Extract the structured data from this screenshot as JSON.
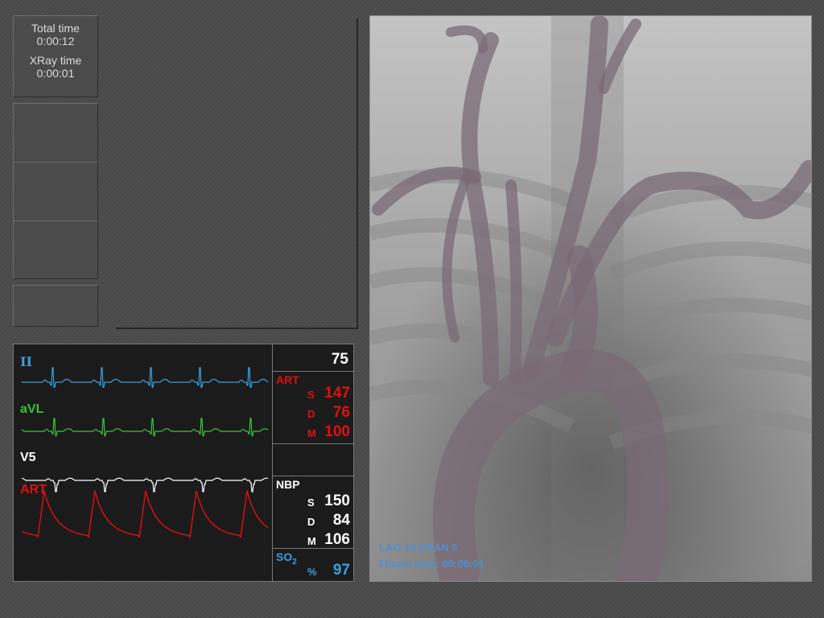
{
  "timers": {
    "total_label": "Total time",
    "total_value": "0:00:12",
    "xray_label": "XRay time",
    "xray_value": "0:00:01"
  },
  "monitor": {
    "waveforms": [
      {
        "label": "II",
        "color": "#3aa0e0"
      },
      {
        "label": "aVL",
        "color": "#3ac23a"
      },
      {
        "label": "V5",
        "color": "#ffffff"
      },
      {
        "label": "ART",
        "color": "#e01010"
      }
    ],
    "heart_rate": "75",
    "art": {
      "label": "ART",
      "s_key": "S",
      "s": "147",
      "d_key": "D",
      "d": "76",
      "m_key": "M",
      "m": "100",
      "color": "#e01010"
    },
    "nbp": {
      "label": "NBP",
      "s_key": "S",
      "s": "150",
      "d_key": "D",
      "d": "84",
      "m_key": "M",
      "m": "106",
      "color": "#ffffff"
    },
    "so2": {
      "label": "SO",
      "sub": "2",
      "key": "%",
      "value": "97",
      "color": "#3aa0e0"
    }
  },
  "fluoro": {
    "angle_text": "LAO  19 CRAN   0",
    "fluoro_time": "Fluoro time:  00:00:01",
    "text_color": "#4f8fd0"
  }
}
